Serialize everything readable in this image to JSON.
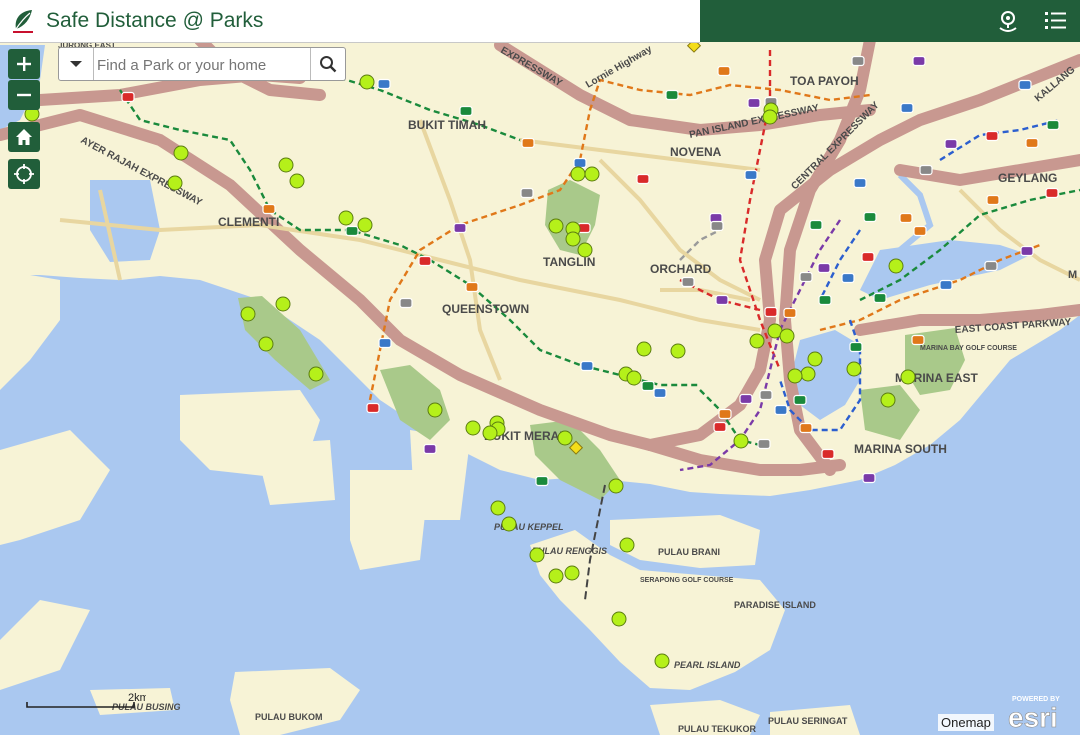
{
  "header": {
    "title": "Safe Distance @ Parks"
  },
  "search": {
    "placeholder": "Find a Park or your home"
  },
  "map": {
    "labels": [
      "TOA PAYOH",
      "BUKIT TIMAH",
      "NOVENA",
      "CLEMENTI",
      "TANGLIN",
      "ORCHARD",
      "QUEENSTOWN",
      "GEYLANG",
      "BUKIT MERAH",
      "MARINA SOUTH",
      "MARINA EAST",
      "MARINA BAY GOLF COURSE",
      "PULAU KEPPEL",
      "PULAU RENGGIS",
      "PULAU BRANI",
      "SERAPONG GOLF COURSE",
      "PARADISE ISLAND",
      "PEARL ISLAND",
      "PULAU BUSING",
      "PULAU BUKOM",
      "PULAU TEKUKOR",
      "PULAU SERINGAT",
      "AYER RAJAH EXPRESSWAY",
      "PAN ISLAND EXPRESSWAY",
      "CENTRAL EXPRESSWAY",
      "EAST COAST PARKWAY",
      "EXPRESSWAY",
      "Lornie Highway",
      "JURONG EAST",
      "KALLANG",
      "M"
    ]
  },
  "scale": {
    "label": "2km"
  },
  "attribution": {
    "basemap": "Onemap",
    "powered": "POWERED BY",
    "brand": "esri"
  },
  "colors": {
    "brand": "#215e3a",
    "park_marker": "#b5f01a"
  }
}
